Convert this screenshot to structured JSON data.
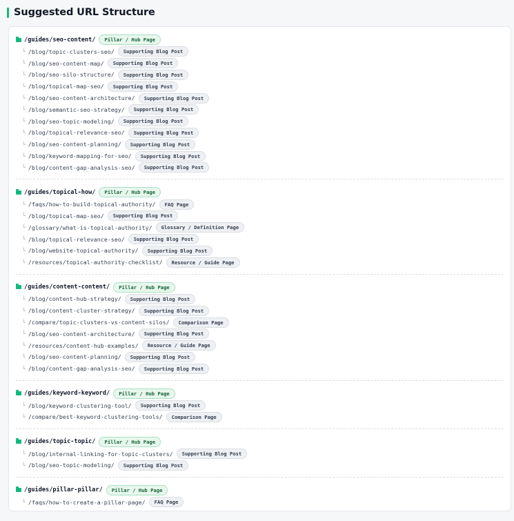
{
  "header": {
    "title": "Suggested URL Structure"
  },
  "icons": {
    "pillar": "folder-icon",
    "branch_glyph": "└"
  },
  "colors": {
    "accent": "#10b981",
    "pillar_badge_bg": "#e8f7ee",
    "child_badge_bg": "#eef0f3"
  },
  "groups": [
    {
      "pillar": {
        "url": "/guides/seo-content/",
        "badge": "Pillar / Hub Page"
      },
      "children": [
        {
          "url": "/blog/topic-clusters-seo/",
          "badge": "Supporting Blog Post"
        },
        {
          "url": "/blog/seo-content-map/",
          "badge": "Supporting Blog Post"
        },
        {
          "url": "/blog/seo-silo-structure/",
          "badge": "Supporting Blog Post"
        },
        {
          "url": "/blog/topical-map-seo/",
          "badge": "Supporting Blog Post"
        },
        {
          "url": "/blog/seo-content-architecture/",
          "badge": "Supporting Blog Post"
        },
        {
          "url": "/blog/semantic-seo-strategy/",
          "badge": "Supporting Blog Post"
        },
        {
          "url": "/blog/seo-topic-modeling/",
          "badge": "Supporting Blog Post"
        },
        {
          "url": "/blog/topical-relevance-seo/",
          "badge": "Supporting Blog Post"
        },
        {
          "url": "/blog/seo-content-planning/",
          "badge": "Supporting Blog Post"
        },
        {
          "url": "/blog/keyword-mapping-for-seo/",
          "badge": "Supporting Blog Post"
        },
        {
          "url": "/blog/content-gap-analysis-seo/",
          "badge": "Supporting Blog Post"
        }
      ]
    },
    {
      "pillar": {
        "url": "/guides/topical-how/",
        "badge": "Pillar / Hub Page"
      },
      "children": [
        {
          "url": "/faqs/how-to-build-topical-authority/",
          "badge": "FAQ Page"
        },
        {
          "url": "/blog/topical-map-seo/",
          "badge": "Supporting Blog Post"
        },
        {
          "url": "/glossary/what-is-topical-authority/",
          "badge": "Glossary / Definition Page"
        },
        {
          "url": "/blog/topical-relevance-seo/",
          "badge": "Supporting Blog Post"
        },
        {
          "url": "/blog/website-topical-authority/",
          "badge": "Supporting Blog Post"
        },
        {
          "url": "/resources/topical-authority-checklist/",
          "badge": "Resource / Guide Page"
        }
      ]
    },
    {
      "pillar": {
        "url": "/guides/content-content/",
        "badge": "Pillar / Hub Page"
      },
      "children": [
        {
          "url": "/blog/content-hub-strategy/",
          "badge": "Supporting Blog Post"
        },
        {
          "url": "/blog/content-cluster-strategy/",
          "badge": "Supporting Blog Post"
        },
        {
          "url": "/compare/topic-clusters-vs-content-silos/",
          "badge": "Comparison Page"
        },
        {
          "url": "/blog/seo-content-architecture/",
          "badge": "Supporting Blog Post"
        },
        {
          "url": "/resources/content-hub-examples/",
          "badge": "Resource / Guide Page"
        },
        {
          "url": "/blog/seo-content-planning/",
          "badge": "Supporting Blog Post"
        },
        {
          "url": "/blog/content-gap-analysis-seo/",
          "badge": "Supporting Blog Post"
        }
      ]
    },
    {
      "pillar": {
        "url": "/guides/keyword-keyword/",
        "badge": "Pillar / Hub Page"
      },
      "children": [
        {
          "url": "/blog/keyword-clustering-tool/",
          "badge": "Supporting Blog Post"
        },
        {
          "url": "/compare/best-keyword-clustering-tools/",
          "badge": "Comparison Page"
        }
      ]
    },
    {
      "pillar": {
        "url": "/guides/topic-topic/",
        "badge": "Pillar / Hub Page"
      },
      "children": [
        {
          "url": "/blog/internal-linking-for-topic-clusters/",
          "badge": "Supporting Blog Post"
        },
        {
          "url": "/blog/seo-topic-modeling/",
          "badge": "Supporting Blog Post"
        }
      ]
    },
    {
      "pillar": {
        "url": "/guides/pillar-pillar/",
        "badge": "Pillar / Hub Page"
      },
      "children": [
        {
          "url": "/faqs/how-to-create-a-pillar-page/",
          "badge": "FAQ Page"
        }
      ]
    }
  ]
}
